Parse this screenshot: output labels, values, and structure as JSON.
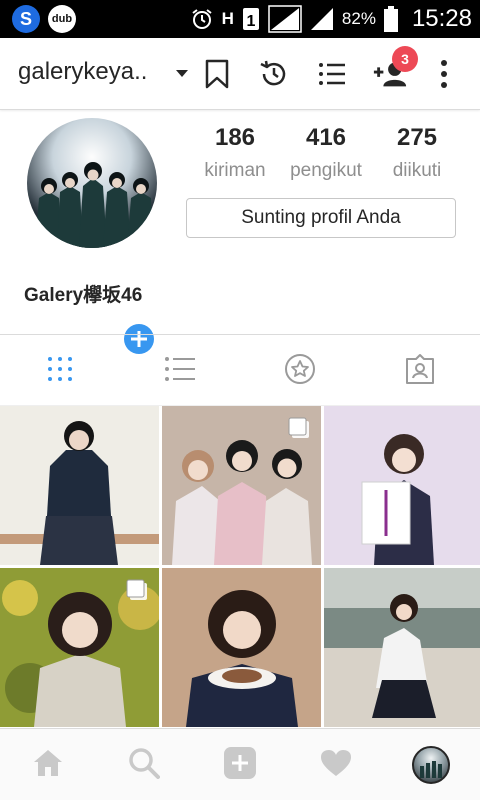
{
  "status_bar": {
    "app1": "S",
    "app2": "dub",
    "battery": "82%",
    "time": "15:28",
    "network": "H"
  },
  "header": {
    "username": "galerykeya..",
    "notification_count": "3"
  },
  "profile": {
    "stats": [
      {
        "value": "186",
        "label": "kiriman"
      },
      {
        "value": "416",
        "label": "pengikut"
      },
      {
        "value": "275",
        "label": "diikuti"
      }
    ],
    "edit_label": "Sunting profil Anda",
    "display_name": "Galery欅坂46"
  },
  "tabs": [
    "grid-icon",
    "list-icon",
    "star-tag-icon",
    "person-tag-icon"
  ],
  "nav": [
    "home-icon",
    "search-icon",
    "add-icon",
    "heart-icon",
    "profile-avatar"
  ],
  "colors": {
    "accent": "#3897f0",
    "badge": "#ed4956",
    "text": "#262626",
    "muted": "#8e8e8e"
  }
}
